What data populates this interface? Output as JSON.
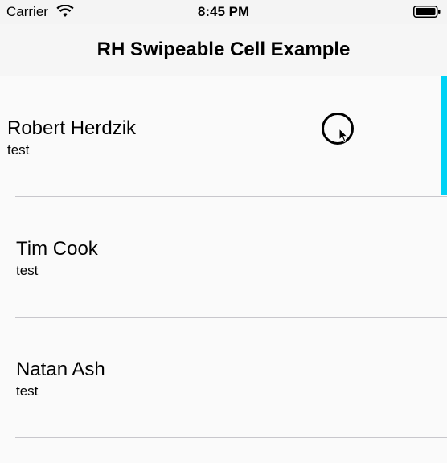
{
  "status_bar": {
    "carrier": "Carrier",
    "time": "8:45 PM",
    "wifi_icon": "wifi-icon",
    "battery_icon": "battery-icon"
  },
  "nav_bar": {
    "title": "RH Swipeable Cell Example"
  },
  "list": {
    "items": [
      {
        "name": "Robert Herdzik",
        "subtitle": "test"
      },
      {
        "name": "Tim Cook",
        "subtitle": "test"
      },
      {
        "name": "Natan Ash",
        "subtitle": "test"
      }
    ]
  },
  "colors": {
    "accent": "#00d2f5",
    "separator": "#c8c7cc",
    "background": "#fafafa"
  },
  "cursor": {
    "icon": "touch-cursor-icon"
  }
}
